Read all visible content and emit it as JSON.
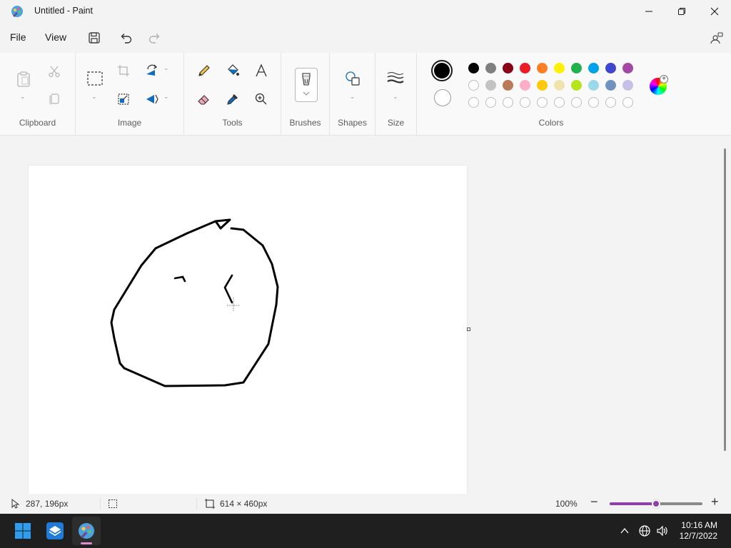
{
  "window": {
    "title": "Untitled - Paint",
    "minimize_icon": "minimize-icon",
    "maximize_icon": "restore-icon",
    "close_icon": "close-icon"
  },
  "menu": {
    "file_label": "File",
    "view_label": "View",
    "save_icon": "save-icon",
    "undo_icon": "undo-icon",
    "redo_icon": "redo-icon",
    "share_icon": "account-icon"
  },
  "ribbon": {
    "groups": {
      "clipboard": "Clipboard",
      "image": "Image",
      "tools": "Tools",
      "brushes": "Brushes",
      "shapes": "Shapes",
      "size": "Size",
      "colors": "Colors"
    },
    "active_colors": {
      "primary": "#000000",
      "secondary": "#ffffff"
    },
    "palette_row1": [
      "#000000",
      "#7f7f7f",
      "#880015",
      "#ed1c24",
      "#ff7f27",
      "#fff200",
      "#22b14c",
      "#00a2e8",
      "#3f48cc",
      "#a349a4"
    ],
    "palette_row2": [
      "#ffffff",
      "#c3c3c3",
      "#b97a57",
      "#ffaec9",
      "#ffc90e",
      "#efe4b0",
      "#b5e61d",
      "#99d9ea",
      "#7092be",
      "#c8bfe7"
    ],
    "palette_row3_empty_count": 10,
    "accent": "#8e3fa8"
  },
  "status": {
    "cursor_position": "287, 196px",
    "canvas_size": "614 × 460px",
    "zoom": "100%",
    "zoom_level": 0.5
  },
  "taskbar": {
    "time": "10:16 AM",
    "date": "12/7/2022"
  }
}
